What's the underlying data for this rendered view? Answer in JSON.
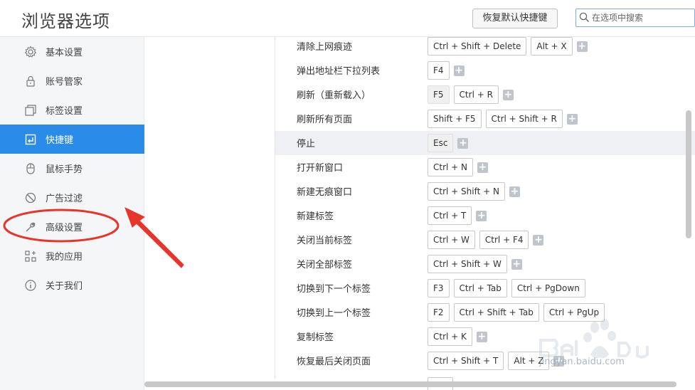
{
  "header": {
    "title": "浏览器选项",
    "restore_button": "恢复默认快捷键",
    "search_placeholder": "在选项中搜索"
  },
  "sidebar": {
    "items": [
      {
        "label": "基本设置",
        "icon": "gear-icon"
      },
      {
        "label": "账号管家",
        "icon": "lock-icon"
      },
      {
        "label": "标签设置",
        "icon": "tabs-icon"
      },
      {
        "label": "快捷键",
        "icon": "shortcut-icon",
        "active": true
      },
      {
        "label": "鼠标手势",
        "icon": "mouse-icon"
      },
      {
        "label": "广告过滤",
        "icon": "block-icon"
      },
      {
        "label": "高级设置",
        "icon": "wrench-icon"
      },
      {
        "label": "我的应用",
        "icon": "apps-icon"
      },
      {
        "label": "关于我们",
        "icon": "info-icon"
      }
    ]
  },
  "shortcuts": [
    {
      "name": "清除上网痕迹",
      "keys": [
        "Ctrl  +  Shift  +  Delete",
        "Alt  +  X"
      ]
    },
    {
      "name": "弹出地址栏下拉列表",
      "keys": [
        "F4"
      ]
    },
    {
      "name": "刷新（重新载入）",
      "keys": [
        "F5",
        "Ctrl  +  R"
      ]
    },
    {
      "name": "刷新所有页面",
      "keys": [
        "Shift  +  F5",
        "Ctrl  +  Shift  +  R"
      ]
    },
    {
      "name": "停止",
      "keys": [
        "Esc"
      ]
    },
    {
      "name": "打开新窗口",
      "keys": [
        "Ctrl  +  N"
      ]
    },
    {
      "name": "新建无痕窗口",
      "keys": [
        "Ctrl  +  Shift  +  N"
      ]
    },
    {
      "name": "新建标签",
      "keys": [
        "Ctrl  +  T"
      ]
    },
    {
      "name": "关闭当前标签",
      "keys": [
        "Ctrl  +  W",
        "Ctrl  +  F4"
      ]
    },
    {
      "name": "关闭全部标签",
      "keys": [
        "Ctrl  +  Shift  +  W"
      ]
    },
    {
      "name": "切换到下一个标签",
      "keys": [
        "F3",
        "Ctrl  +  Tab",
        "Ctrl  +  PgDown"
      ]
    },
    {
      "name": "切换到上一个标签",
      "keys": [
        "F2",
        "Ctrl  +  Shift  +  Tab",
        "Ctrl  +  PgUp"
      ]
    },
    {
      "name": "复制标签",
      "keys": [
        "Ctrl  +  K"
      ]
    },
    {
      "name": "恢复最后关闭页面",
      "keys": [
        "Ctrl  +  Shift  +  T",
        "Alt  +  Z"
      ]
    }
  ],
  "watermark": {
    "text": "jingyan.baidu.com"
  },
  "colors": {
    "accent": "#2a8ce8",
    "annotation": "#e8352c"
  }
}
